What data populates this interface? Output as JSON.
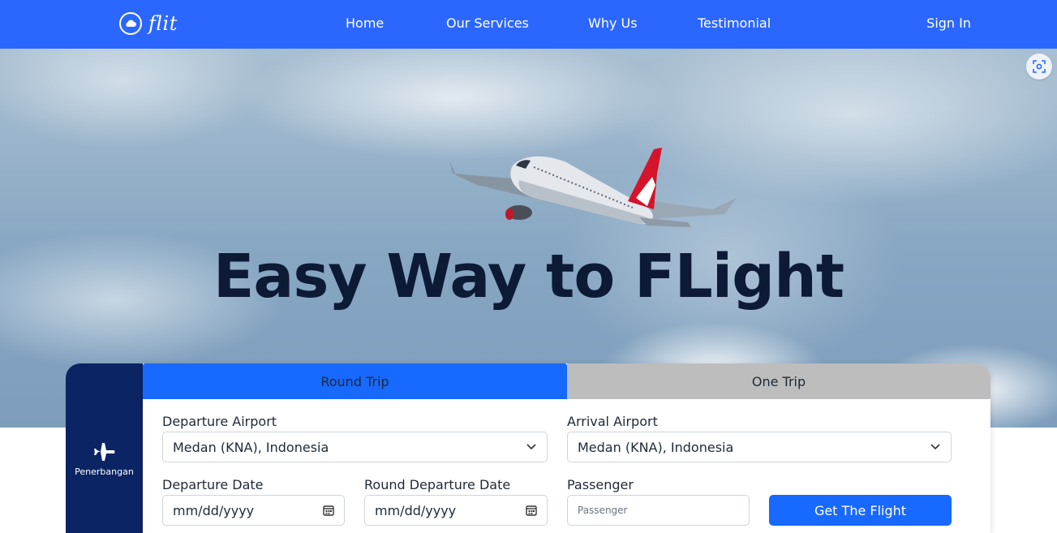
{
  "nav": {
    "logo_text": "flit",
    "links": [
      "Home",
      "Our Services",
      "Why Us",
      "Testimonial"
    ],
    "signin": "Sign In"
  },
  "hero": {
    "title": "Easy Way to FLight"
  },
  "booking": {
    "side_label": "Penerbangan",
    "tabs": {
      "round_trip": "Round Trip",
      "one_trip": "One Trip"
    },
    "departure_airport": {
      "label": "Departure Airport",
      "value": "Medan (KNA), Indonesia"
    },
    "arrival_airport": {
      "label": "Arrival Airport",
      "value": "Medan (KNA), Indonesia"
    },
    "departure_date": {
      "label": "Departure Date",
      "value": "mm/dd/yyyy"
    },
    "round_departure_date": {
      "label": "Round Departure Date",
      "value": "mm/dd/yyyy"
    },
    "passenger": {
      "label": "Passenger",
      "placeholder": "Passenger"
    },
    "submit": "Get The Flight"
  },
  "colors": {
    "nav_bg": "#2b67fe",
    "accent": "#1769ff",
    "side_panel": "#0b2463",
    "tab_inactive": "#bdbdbd",
    "hero_title": "#0d1a36"
  },
  "icons": {
    "logo": "cloud-icon",
    "scan": "scan-icon",
    "side": "airplane-icon",
    "select": "chevron-down-icon",
    "date": "calendar-icon"
  }
}
